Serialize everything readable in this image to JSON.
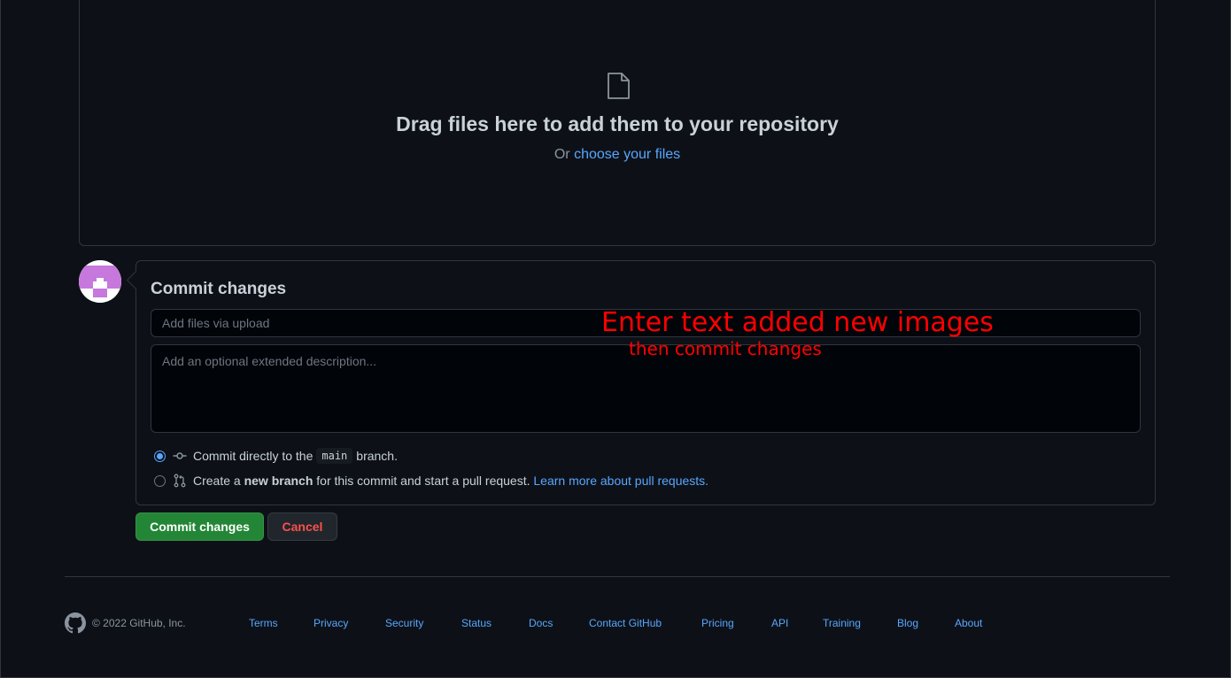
{
  "dropzone": {
    "icon": "file-icon",
    "title": "Drag files here to add them to your repository",
    "or_text": "Or ",
    "choose_link": "choose your files"
  },
  "commit": {
    "title": "Commit changes",
    "summary_placeholder": "Add files via upload",
    "description_placeholder": "Add an optional extended description...",
    "option_direct": {
      "prefix": "Commit directly to the",
      "branch": "main",
      "suffix": "branch.",
      "icon": "git-commit-icon",
      "checked": true
    },
    "option_new_branch": {
      "prefix": "Create a",
      "bold": "new branch",
      "suffix": "for this commit and start a pull request.",
      "link": "Learn more about pull requests.",
      "icon": "git-pull-request-icon",
      "checked": false
    },
    "commit_button": "Commit changes",
    "cancel_button": "Cancel"
  },
  "annotation": {
    "line1": "Enter text added new images",
    "line2": "then commit changes",
    "color": "#ff0000"
  },
  "footer": {
    "copyright": "© 2022 GitHub, Inc.",
    "links": [
      "Terms",
      "Privacy",
      "Security",
      "Status",
      "Docs",
      "Contact GitHub",
      "Pricing",
      "API",
      "Training",
      "Blog",
      "About"
    ]
  },
  "colors": {
    "background": "#0d1117",
    "link": "#58a6ff",
    "primary_button": "#238636",
    "danger_text": "#f85149"
  }
}
